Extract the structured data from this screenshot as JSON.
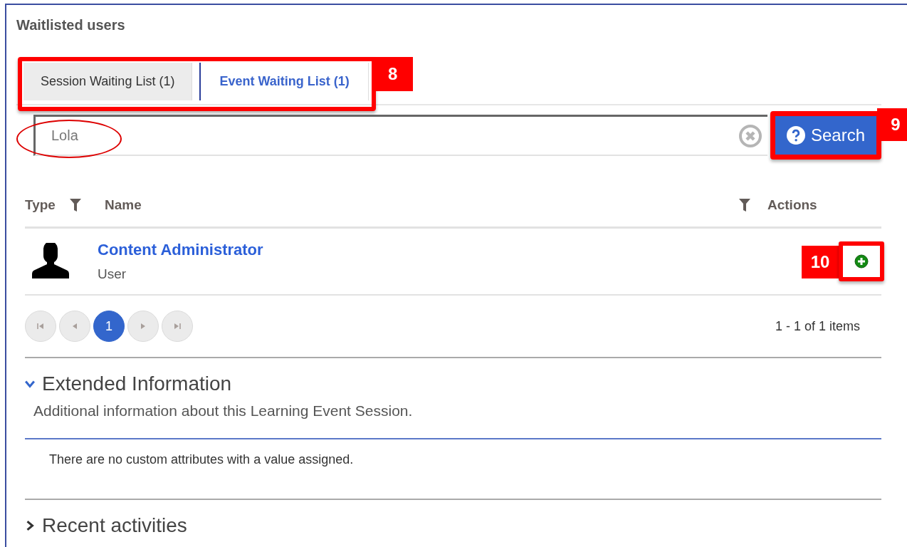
{
  "panel": {
    "title": "Waitlisted users"
  },
  "tabs": {
    "callout": "8",
    "items": [
      {
        "label": "Session Waiting List (1)",
        "selected": false
      },
      {
        "label": "Event Waiting List (1)",
        "selected": true
      }
    ]
  },
  "search": {
    "value": "Lola",
    "circled": true,
    "button": "Search",
    "callout": "9"
  },
  "table": {
    "columns": [
      {
        "label": "Type",
        "filter": true
      },
      {
        "label": "Name",
        "filter": true
      },
      {
        "label": "Actions",
        "filter": false
      }
    ],
    "rows": [
      {
        "name": "Content Administrator",
        "type": "User",
        "action_callout": "10"
      }
    ]
  },
  "pager": {
    "buttons": [
      {
        "kind": "first",
        "disabled": true
      },
      {
        "kind": "prev",
        "disabled": true
      },
      {
        "kind": "page",
        "label": "1",
        "selected": true
      },
      {
        "kind": "next",
        "disabled": true
      },
      {
        "kind": "last",
        "disabled": true
      }
    ],
    "summary": "1 - 1 of 1 items"
  },
  "sections": [
    {
      "title": "Extended Information",
      "expanded": true,
      "description": "Additional information about this Learning Event Session.",
      "body": "There are no custom attributes with a value assigned."
    },
    {
      "title": "Recent activities",
      "expanded": false
    }
  ]
}
